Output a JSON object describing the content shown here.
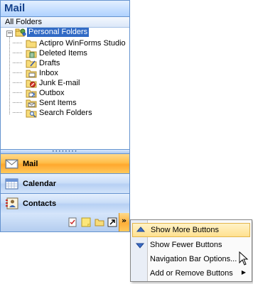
{
  "pane": {
    "title": "Mail",
    "section_label": "All Folders",
    "root_folder": "Personal Folders",
    "expander_symbol": "−",
    "folders": [
      {
        "label": "Actipro WinForms Studio",
        "icon": "folder-icon"
      },
      {
        "label": "Deleted Items",
        "icon": "deleted-items-icon"
      },
      {
        "label": "Drafts",
        "icon": "drafts-icon"
      },
      {
        "label": "Inbox",
        "icon": "inbox-icon"
      },
      {
        "label": "Junk E-mail",
        "icon": "junk-email-icon"
      },
      {
        "label": "Outbox",
        "icon": "outbox-icon"
      },
      {
        "label": "Sent Items",
        "icon": "sent-items-icon"
      },
      {
        "label": "Search Folders",
        "icon": "search-folders-icon"
      }
    ]
  },
  "nav_buttons": [
    {
      "label": "Mail",
      "icon": "mail-icon",
      "selected": true
    },
    {
      "label": "Calendar",
      "icon": "calendar-icon",
      "selected": false
    },
    {
      "label": "Contacts",
      "icon": "contacts-icon",
      "selected": false
    }
  ],
  "overflow": {
    "icons": [
      "tasks-icon",
      "notes-icon",
      "folder-list-icon",
      "shortcuts-icon"
    ],
    "chevron": "»"
  },
  "menu": {
    "items": [
      {
        "label": "Show More Buttons",
        "icon": "show-more-icon",
        "highlighted": true
      },
      {
        "label": "Show Fewer Buttons",
        "icon": "show-fewer-icon",
        "highlighted": false
      },
      {
        "label": "Navigation Bar Options...",
        "icon": "",
        "highlighted": false
      },
      {
        "label": "Add or Remove Buttons",
        "icon": "",
        "highlighted": false,
        "submenu": true
      }
    ],
    "submenu_arrow": "▶"
  },
  "colors": {
    "accent": "#15428b",
    "border": "#6593cf",
    "selected": "#ffbe4a",
    "selection_highlight": "#316ac5"
  }
}
